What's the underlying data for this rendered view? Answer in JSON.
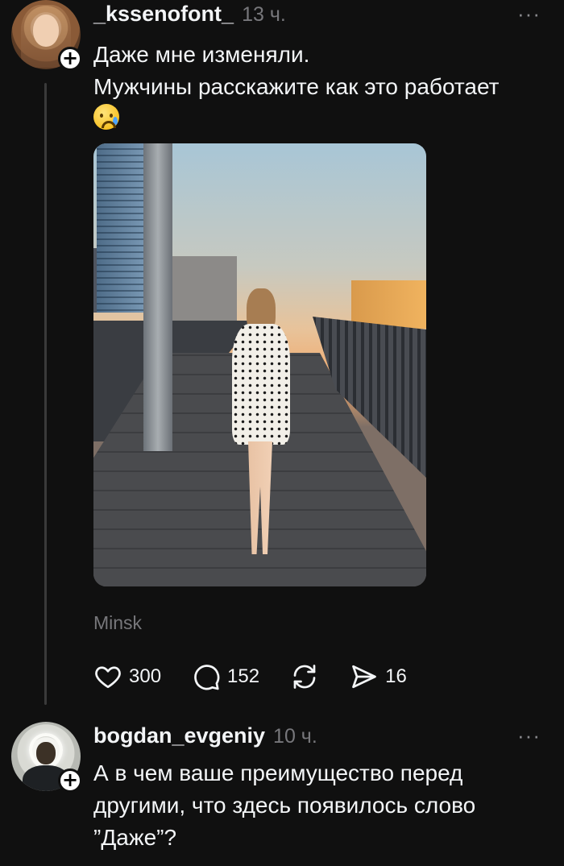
{
  "posts": [
    {
      "username": "_kssenofont_",
      "time": "13 ч.",
      "text_lines": [
        "Даже мне изменяли.",
        "Мужчины расскажите как это работает"
      ],
      "emoji_icon": "crying-face-emoji",
      "location": "Minsk",
      "likes": "300",
      "comments": "152",
      "shares": "16"
    },
    {
      "username": "bogdan_evgeniy",
      "time": "10 ч.",
      "text_lines": [
        "А в чем ваше преимущество перед",
        "другими, что здесь появилось слово",
        "”Даже”?"
      ]
    }
  ],
  "more_label": "···",
  "follow_label": "+",
  "colors": {
    "background": "#101010",
    "text": "#f3f5f7",
    "muted": "#77777b"
  }
}
